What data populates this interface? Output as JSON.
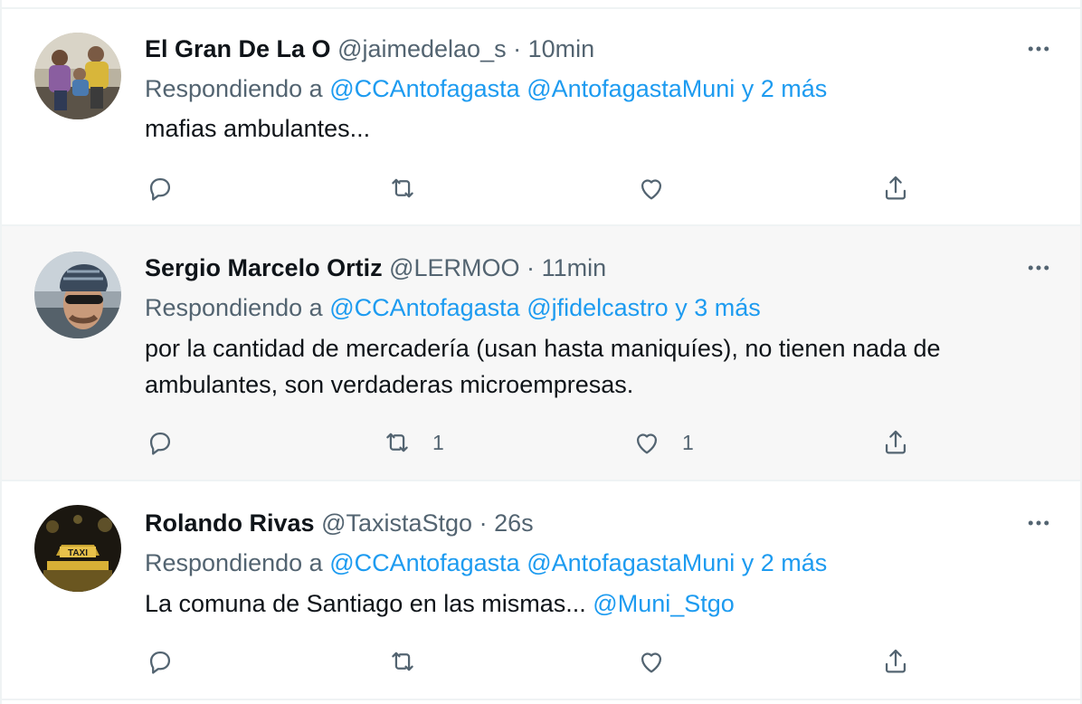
{
  "tweets": [
    {
      "name": "El Gran De La O",
      "handle": "@jaimedelao_s",
      "separator": "·",
      "time": "10min",
      "replying_prefix": "Respondiendo a",
      "reply_mention_1": "@CCAntofagasta",
      "reply_mention_2": "@AntofagastaMuni",
      "reply_more": "y 2 más",
      "text_line_1": "mafias ambulantes...",
      "text_line_2": "",
      "text_mention": "",
      "reply_count": "",
      "retweet_count": "",
      "like_count": ""
    },
    {
      "name": "Sergio Marcelo Ortiz",
      "handle": "@LERMOO",
      "separator": "·",
      "time": "11min",
      "replying_prefix": "Respondiendo a",
      "reply_mention_1": "@CCAntofagasta",
      "reply_mention_2": "@jfidelcastro",
      "reply_more": "y 3 más",
      "text_line_1": "por la cantidad de mercadería (usan hasta maniquíes), no tienen nada de",
      "text_line_2": "ambulantes, son verdaderas microempresas.",
      "text_mention": "",
      "reply_count": "",
      "retweet_count": "1",
      "like_count": "1"
    },
    {
      "name": "Rolando Rivas",
      "handle": "@TaxistaStgo",
      "separator": "·",
      "time": "26s",
      "replying_prefix": "Respondiendo a",
      "reply_mention_1": "@CCAntofagasta",
      "reply_mention_2": "@AntofagastaMuni",
      "reply_more": "y 2 más",
      "text_line_1": "La comuna de Santiago en las mismas...",
      "text_line_2": "",
      "text_mention": "@Muni_Stgo",
      "reply_count": "",
      "retweet_count": "",
      "like_count": ""
    }
  ],
  "avatar_texts": {
    "taxi_sign": "TAXI"
  },
  "icons": {
    "reply": "reply-icon",
    "retweet": "retweet-icon",
    "like": "heart-icon",
    "share": "share-icon",
    "more": "more-icon"
  },
  "colors": {
    "link": "#1d9bf0",
    "secondary": "#536471",
    "primary": "#0f1419",
    "hover_bg": "#f7f7f7",
    "border": "#eff3f4"
  }
}
